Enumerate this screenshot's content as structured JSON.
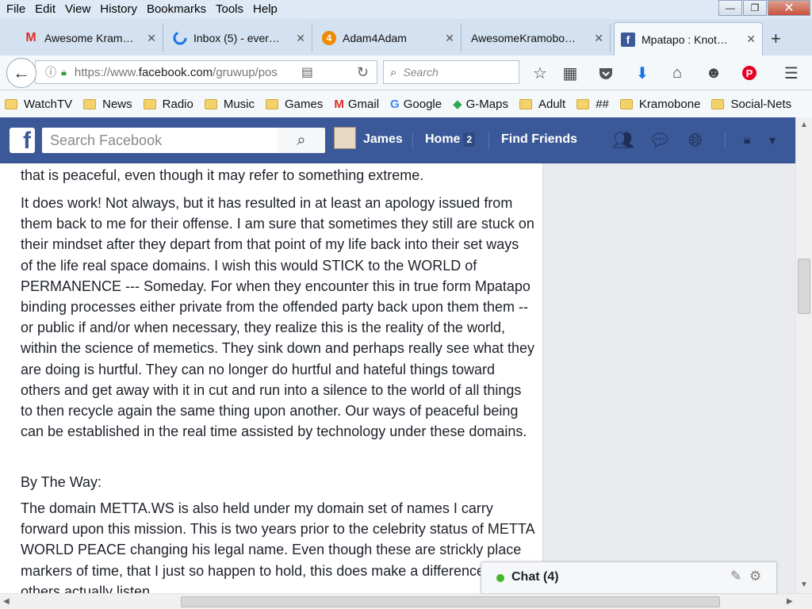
{
  "menu": [
    "File",
    "Edit",
    "View",
    "History",
    "Bookmarks",
    "Tools",
    "Help"
  ],
  "window_controls": {
    "minimize": "—",
    "maximize": "❐",
    "close": "✕"
  },
  "tabs": [
    {
      "label": "Awesome Kram…",
      "icon": "gmail-icon",
      "active": false
    },
    {
      "label": "Inbox (5) - ever…",
      "icon": "inbox-icon",
      "active": false
    },
    {
      "label": "Adam4Adam",
      "icon": "a4a-icon",
      "active": false
    },
    {
      "label": "AwesomeKramobo…",
      "icon": "none",
      "active": false
    },
    {
      "label": "Mpatapo : Knot…",
      "icon": "facebook-icon",
      "active": true
    }
  ],
  "new_tab_label": "+",
  "url": {
    "prefix": "https://www.",
    "domain": "facebook.com",
    "path": "/gruwup/pos"
  },
  "search_placeholder": "Search",
  "bookmarks": [
    {
      "label": "WatchTV",
      "icon": "folder"
    },
    {
      "label": "News",
      "icon": "folder"
    },
    {
      "label": "Radio",
      "icon": "folder"
    },
    {
      "label": "Music",
      "icon": "folder"
    },
    {
      "label": "Games",
      "icon": "folder"
    },
    {
      "label": "Gmail",
      "icon": "gmail"
    },
    {
      "label": "Google",
      "icon": "google"
    },
    {
      "label": "G-Maps",
      "icon": "maps"
    },
    {
      "label": "Adult",
      "icon": "folder"
    },
    {
      "label": "##",
      "icon": "folder"
    },
    {
      "label": "Kramobone",
      "icon": "folder"
    },
    {
      "label": "Social-Nets",
      "icon": "folder"
    }
  ],
  "facebook": {
    "search_placeholder": "Search Facebook",
    "user": "James",
    "home": "Home",
    "home_badge": "2",
    "find_friends": "Find Friends"
  },
  "post": {
    "p1": "that is peaceful, even though it may refer to something extreme.",
    "p2": "It does work! Not always, but it has resulted in at least an apology issued from them back to me for their offense. I am sure that sometimes they still are stuck on their mindset after they depart from that point of my life back into their set ways of the life real space domains. I wish this would STICK to the WORLD of PERMANENCE --- Someday. For when they encounter this in true form Mpatapo binding processes either private from the offended party back upon them them -- or public if and/or when necessary, they realize this is the reality of the world, within the science of memetics. They sink down and perhaps really see what they are doing is hurtful. They can no longer do hurtful and hateful things toward others and get away with it in cut and run into a silence to the world of all things to then recycle again the same thing upon another. Our ways of peaceful being can be established in the real time assisted by technology under these domains.",
    "p3": "By The Way:",
    "p4": "The domain METTA.WS is also held under my domain set of names I carry forward upon this mission. This is two years prior to the celebrity status of METTA WORLD PEACE changing his legal name. Even though these are strickly place markers of time, that I just so happen to hold, this does make a difference that others actually listen"
  },
  "chat": {
    "label": "Chat (4)"
  }
}
